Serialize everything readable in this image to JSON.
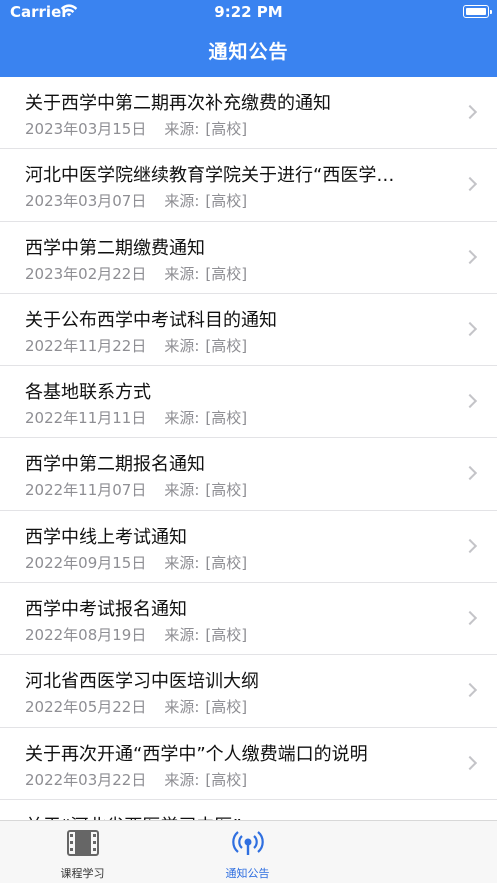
{
  "status_bar": {
    "carrier": "Carrier",
    "time": "9:22 PM"
  },
  "header": {
    "title": "通知公告"
  },
  "notices": [
    {
      "title": "关于西学中第二期再次补充缴费的通知",
      "date": "2023年03月15日",
      "source_label": "来源:",
      "source": "[高校]"
    },
    {
      "title": "河北中医学院继续教育学院关于进行“西医学…",
      "date": "2023年03月07日",
      "source_label": "来源:",
      "source": "[高校]"
    },
    {
      "title": "西学中第二期缴费通知",
      "date": "2023年02月22日",
      "source_label": "来源:",
      "source": "[高校]"
    },
    {
      "title": "关于公布西学中考试科目的通知",
      "date": "2022年11月22日",
      "source_label": "来源:",
      "source": "[高校]"
    },
    {
      "title": "各基地联系方式",
      "date": "2022年11月11日",
      "source_label": "来源:",
      "source": "[高校]"
    },
    {
      "title": "西学中第二期报名通知",
      "date": "2022年11月07日",
      "source_label": "来源:",
      "source": "[高校]"
    },
    {
      "title": "西学中线上考试通知",
      "date": "2022年09月15日",
      "source_label": "来源:",
      "source": "[高校]"
    },
    {
      "title": "西学中考试报名通知",
      "date": "2022年08月19日",
      "source_label": "来源:",
      "source": "[高校]"
    },
    {
      "title": "河北省西医学习中医培训大纲",
      "date": "2022年05月22日",
      "source_label": "来源:",
      "source": "[高校]"
    },
    {
      "title": "关于再次开通“西学中”个人缴费端口的说明",
      "date": "2022年03月22日",
      "source_label": "来源:",
      "source": "[高校]"
    },
    {
      "title": "关于“河北省西医学习中医”",
      "date": "",
      "source_label": "",
      "source": ""
    }
  ],
  "tabbar": {
    "tabs": [
      {
        "label": "课程学习",
        "icon": "film-icon",
        "active": false
      },
      {
        "label": "通知公告",
        "icon": "broadcast-icon",
        "active": true
      }
    ]
  },
  "colors": {
    "header_bg": "#3a83f0",
    "tab_active": "#2f6fe0",
    "meta_text": "#8e8e93"
  }
}
